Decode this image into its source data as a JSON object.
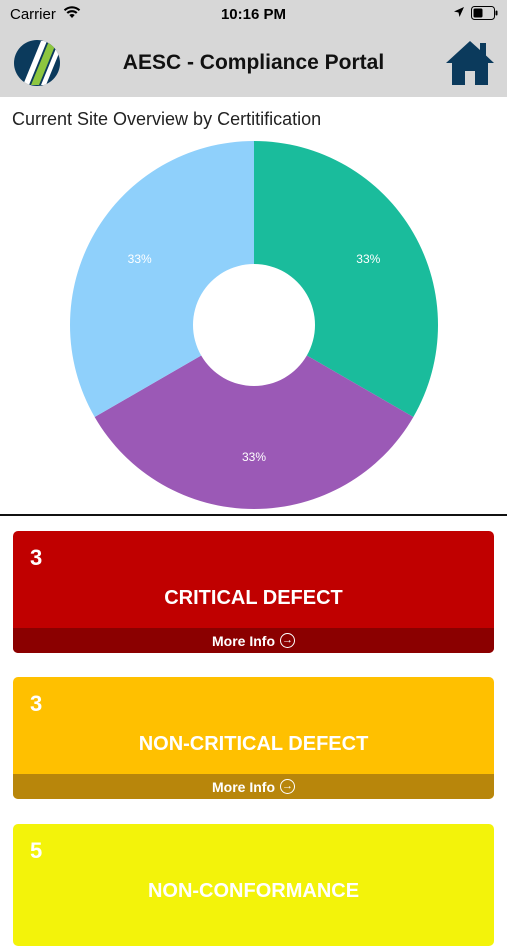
{
  "status_bar": {
    "carrier": "Carrier",
    "time": "10:16 PM",
    "icons": [
      "wifi-icon",
      "location-arrow-icon",
      "battery-icon"
    ]
  },
  "header": {
    "title": "AESC - Compliance Portal",
    "logo_icon": "company-logo-icon",
    "home_icon": "home-icon",
    "background": "#d7d7d7",
    "home_color": "#0b3a5c"
  },
  "chart_title": "Current Site Overview by Certitification",
  "chart_data": {
    "type": "pie",
    "donut": true,
    "slices": [
      {
        "value": 33.33,
        "label": "33%",
        "color": "#1abc9c"
      },
      {
        "value": 33.33,
        "label": "33%",
        "color": "#9b59b6"
      },
      {
        "value": 33.33,
        "label": "33%",
        "color": "#8fd0fb"
      }
    ]
  },
  "cards": [
    {
      "count": "3",
      "title": "CRITICAL DEFECT",
      "more_info": "More Info",
      "color": "#c00000",
      "footer_color": "#8b0000"
    },
    {
      "count": "3",
      "title": "NON-CRITICAL DEFECT",
      "more_info": "More Info",
      "color": "#ffc000",
      "footer_color": "#b8860b"
    },
    {
      "count": "5",
      "title": "NON-CONFORMANCE",
      "color": "#f3f30a"
    }
  ]
}
